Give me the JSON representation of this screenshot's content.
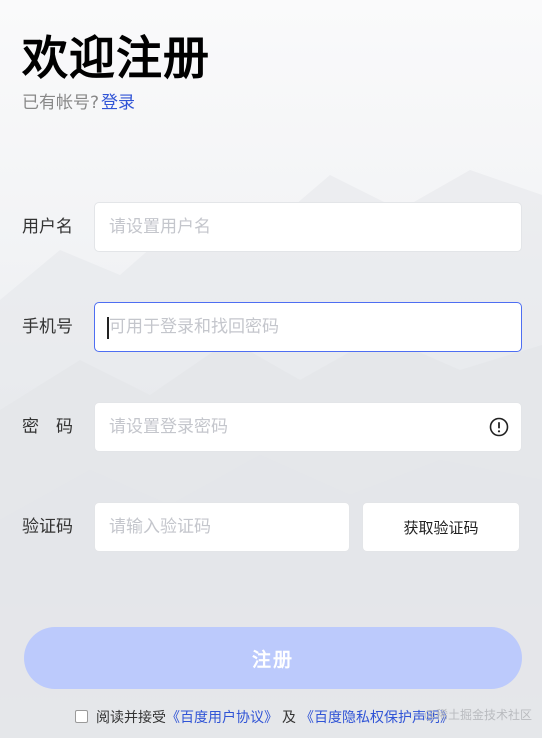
{
  "header": {
    "title": "欢迎注册",
    "login_prompt": "已有帐号?",
    "login_link": "登录"
  },
  "form": {
    "username": {
      "label": "用户名",
      "placeholder": "请设置用户名",
      "value": ""
    },
    "phone": {
      "label": "手机号",
      "placeholder": "可用于登录和找回密码",
      "value": ""
    },
    "password": {
      "label": "密　码",
      "placeholder": "请设置登录密码",
      "value": "",
      "icon": "warning-circle-icon"
    },
    "code": {
      "label": "验证码",
      "placeholder": "请输入验证码",
      "value": "",
      "button_label": "获取验证码"
    }
  },
  "submit": {
    "label": "注册",
    "color": "#bccafc"
  },
  "agreement": {
    "prefix": "阅读并接受",
    "doc1": "《百度用户协议》",
    "connector": "及",
    "doc2": "《百度隐私权保护声明》",
    "checked": false
  },
  "watermark": "@稀土掘金技术社区",
  "colors": {
    "accent": "#4e6ef2",
    "link": "#3054d6",
    "placeholder": "#c4c6cc"
  }
}
